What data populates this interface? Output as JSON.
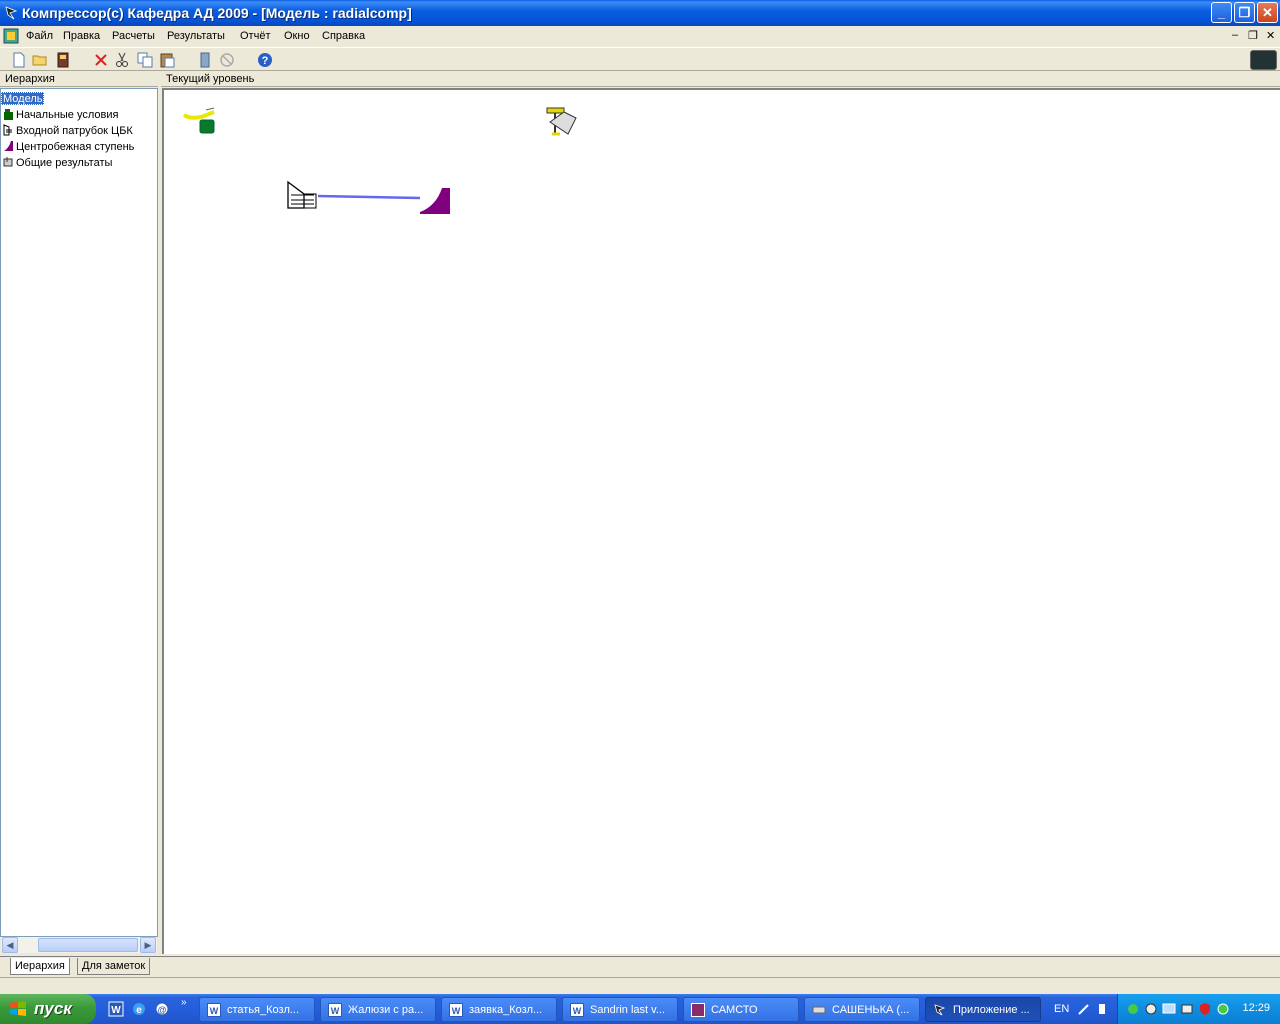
{
  "window": {
    "title": "Компрессор(c) Кафедра АД 2009 - [Модель : radialcomp]",
    "buttons": {
      "minimize": "_",
      "maximize": "❐",
      "close": "✕"
    }
  },
  "menu": {
    "items": [
      "Файл",
      "Правка",
      "Расчеты",
      "Результаты",
      "Отчёт",
      "Окно",
      "Справка"
    ],
    "mdi": {
      "minimize": "–",
      "restore": "❐",
      "close": "✕"
    }
  },
  "toolbar": {
    "buttons": [
      "new-icon",
      "open-icon",
      "save-icon",
      "delete-icon",
      "cut-icon",
      "copy-icon",
      "paste-icon",
      "calc-icon",
      "stop-icon",
      "help-icon"
    ]
  },
  "left_panel": {
    "header": "Иерархия",
    "tree": {
      "root": "Модель",
      "items": [
        {
          "label": "Начальные условия",
          "icon": "initial-conditions-icon",
          "color": "#006600"
        },
        {
          "label": "Входной патрубок ЦБК",
          "icon": "inlet-icon",
          "color": "#000000"
        },
        {
          "label": "Центробежная ступень",
          "icon": "stage-icon",
          "color": "#800080"
        },
        {
          "label": "Общие результаты",
          "icon": "results-icon",
          "color": "#404040"
        }
      ]
    }
  },
  "right_panel": {
    "header": "Текущий уровень",
    "connector_color": "#6666ee"
  },
  "bottom_tabs": [
    "Иерархия",
    "Для заметок"
  ],
  "taskbar": {
    "start": "пуск",
    "tasks": [
      {
        "label": "статья_Козл...",
        "icon": "word-icon"
      },
      {
        "label": "Жалюзи с ра...",
        "icon": "word-icon"
      },
      {
        "label": "заявка_Козл...",
        "icon": "word-icon"
      },
      {
        "label": "Sandrin last v...",
        "icon": "word-icon"
      },
      {
        "label": "САМСТО",
        "icon": "app-icon"
      },
      {
        "label": "САШЕНЬКА (...",
        "icon": "drive-icon"
      },
      {
        "label": "Приложение ...",
        "icon": "compressor-icon"
      }
    ],
    "language": "EN",
    "clock": "12:29"
  }
}
